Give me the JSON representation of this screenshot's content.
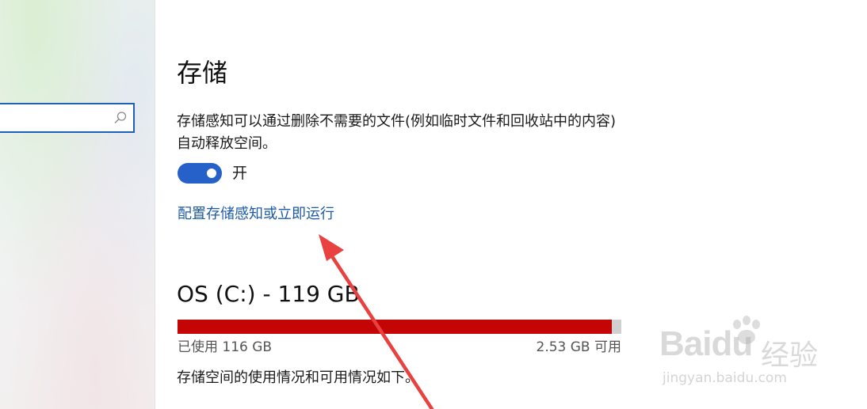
{
  "sidebar": {
    "search": {
      "value": "",
      "placeholder": "",
      "icon": "search-icon"
    }
  },
  "main": {
    "title": "存储",
    "description": "存储感知可以通过删除不需要的文件(例如临时文件和回收站中的内容)自动释放空间。",
    "toggle": {
      "state_label": "开",
      "on": true
    },
    "config_link": "配置存储感知或立即运行",
    "drive": {
      "title": "OS (C:) - 119 GB",
      "used_label": "已使用 116 GB",
      "free_label": "2.53 GB 可用",
      "used_fraction": 0.979
    },
    "usage_description": "存储空间的使用情况和可用情况如下。"
  },
  "watermark": {
    "logo": "Baidu",
    "cn": "经验",
    "url": "jingyan.baidu.com"
  },
  "colors": {
    "accent": "#2561c9",
    "link": "#1d5aa8",
    "usage_fill": "#c30505",
    "arrow": "#e8413f"
  }
}
